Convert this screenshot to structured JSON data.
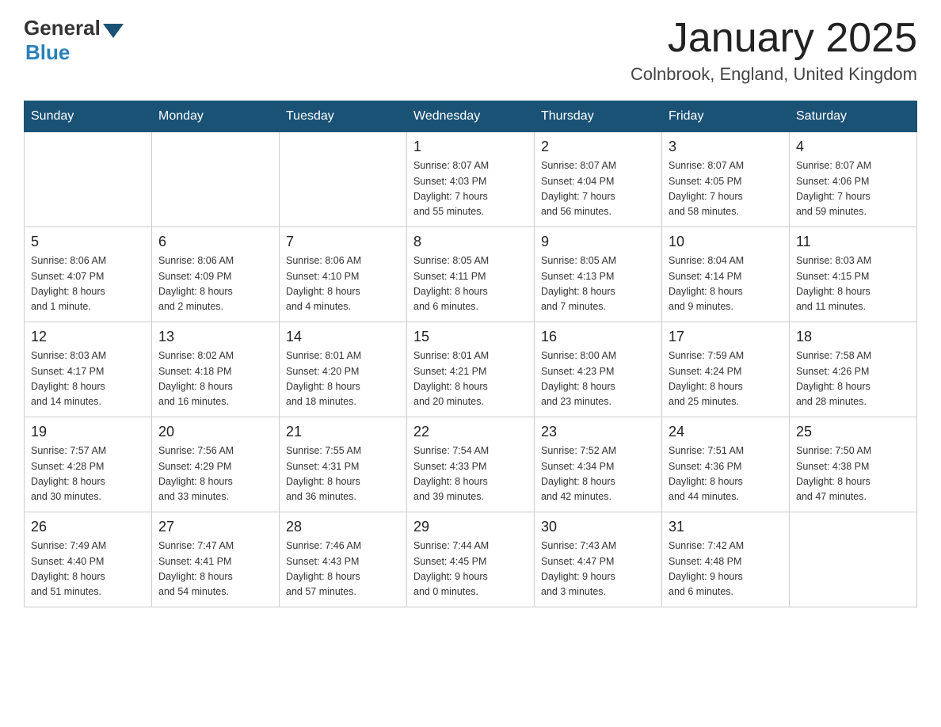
{
  "header": {
    "logo": {
      "general": "General",
      "arrow_color": "#1a5276",
      "blue": "Blue"
    },
    "title": "January 2025",
    "location": "Colnbrook, England, United Kingdom"
  },
  "days_of_week": [
    "Sunday",
    "Monday",
    "Tuesday",
    "Wednesday",
    "Thursday",
    "Friday",
    "Saturday"
  ],
  "weeks": [
    [
      {
        "day": "",
        "info": ""
      },
      {
        "day": "",
        "info": ""
      },
      {
        "day": "",
        "info": ""
      },
      {
        "day": "1",
        "info": "Sunrise: 8:07 AM\nSunset: 4:03 PM\nDaylight: 7 hours\nand 55 minutes."
      },
      {
        "day": "2",
        "info": "Sunrise: 8:07 AM\nSunset: 4:04 PM\nDaylight: 7 hours\nand 56 minutes."
      },
      {
        "day": "3",
        "info": "Sunrise: 8:07 AM\nSunset: 4:05 PM\nDaylight: 7 hours\nand 58 minutes."
      },
      {
        "day": "4",
        "info": "Sunrise: 8:07 AM\nSunset: 4:06 PM\nDaylight: 7 hours\nand 59 minutes."
      }
    ],
    [
      {
        "day": "5",
        "info": "Sunrise: 8:06 AM\nSunset: 4:07 PM\nDaylight: 8 hours\nand 1 minute."
      },
      {
        "day": "6",
        "info": "Sunrise: 8:06 AM\nSunset: 4:09 PM\nDaylight: 8 hours\nand 2 minutes."
      },
      {
        "day": "7",
        "info": "Sunrise: 8:06 AM\nSunset: 4:10 PM\nDaylight: 8 hours\nand 4 minutes."
      },
      {
        "day": "8",
        "info": "Sunrise: 8:05 AM\nSunset: 4:11 PM\nDaylight: 8 hours\nand 6 minutes."
      },
      {
        "day": "9",
        "info": "Sunrise: 8:05 AM\nSunset: 4:13 PM\nDaylight: 8 hours\nand 7 minutes."
      },
      {
        "day": "10",
        "info": "Sunrise: 8:04 AM\nSunset: 4:14 PM\nDaylight: 8 hours\nand 9 minutes."
      },
      {
        "day": "11",
        "info": "Sunrise: 8:03 AM\nSunset: 4:15 PM\nDaylight: 8 hours\nand 11 minutes."
      }
    ],
    [
      {
        "day": "12",
        "info": "Sunrise: 8:03 AM\nSunset: 4:17 PM\nDaylight: 8 hours\nand 14 minutes."
      },
      {
        "day": "13",
        "info": "Sunrise: 8:02 AM\nSunset: 4:18 PM\nDaylight: 8 hours\nand 16 minutes."
      },
      {
        "day": "14",
        "info": "Sunrise: 8:01 AM\nSunset: 4:20 PM\nDaylight: 8 hours\nand 18 minutes."
      },
      {
        "day": "15",
        "info": "Sunrise: 8:01 AM\nSunset: 4:21 PM\nDaylight: 8 hours\nand 20 minutes."
      },
      {
        "day": "16",
        "info": "Sunrise: 8:00 AM\nSunset: 4:23 PM\nDaylight: 8 hours\nand 23 minutes."
      },
      {
        "day": "17",
        "info": "Sunrise: 7:59 AM\nSunset: 4:24 PM\nDaylight: 8 hours\nand 25 minutes."
      },
      {
        "day": "18",
        "info": "Sunrise: 7:58 AM\nSunset: 4:26 PM\nDaylight: 8 hours\nand 28 minutes."
      }
    ],
    [
      {
        "day": "19",
        "info": "Sunrise: 7:57 AM\nSunset: 4:28 PM\nDaylight: 8 hours\nand 30 minutes."
      },
      {
        "day": "20",
        "info": "Sunrise: 7:56 AM\nSunset: 4:29 PM\nDaylight: 8 hours\nand 33 minutes."
      },
      {
        "day": "21",
        "info": "Sunrise: 7:55 AM\nSunset: 4:31 PM\nDaylight: 8 hours\nand 36 minutes."
      },
      {
        "day": "22",
        "info": "Sunrise: 7:54 AM\nSunset: 4:33 PM\nDaylight: 8 hours\nand 39 minutes."
      },
      {
        "day": "23",
        "info": "Sunrise: 7:52 AM\nSunset: 4:34 PM\nDaylight: 8 hours\nand 42 minutes."
      },
      {
        "day": "24",
        "info": "Sunrise: 7:51 AM\nSunset: 4:36 PM\nDaylight: 8 hours\nand 44 minutes."
      },
      {
        "day": "25",
        "info": "Sunrise: 7:50 AM\nSunset: 4:38 PM\nDaylight: 8 hours\nand 47 minutes."
      }
    ],
    [
      {
        "day": "26",
        "info": "Sunrise: 7:49 AM\nSunset: 4:40 PM\nDaylight: 8 hours\nand 51 minutes."
      },
      {
        "day": "27",
        "info": "Sunrise: 7:47 AM\nSunset: 4:41 PM\nDaylight: 8 hours\nand 54 minutes."
      },
      {
        "day": "28",
        "info": "Sunrise: 7:46 AM\nSunset: 4:43 PM\nDaylight: 8 hours\nand 57 minutes."
      },
      {
        "day": "29",
        "info": "Sunrise: 7:44 AM\nSunset: 4:45 PM\nDaylight: 9 hours\nand 0 minutes."
      },
      {
        "day": "30",
        "info": "Sunrise: 7:43 AM\nSunset: 4:47 PM\nDaylight: 9 hours\nand 3 minutes."
      },
      {
        "day": "31",
        "info": "Sunrise: 7:42 AM\nSunset: 4:48 PM\nDaylight: 9 hours\nand 6 minutes."
      },
      {
        "day": "",
        "info": ""
      }
    ]
  ]
}
